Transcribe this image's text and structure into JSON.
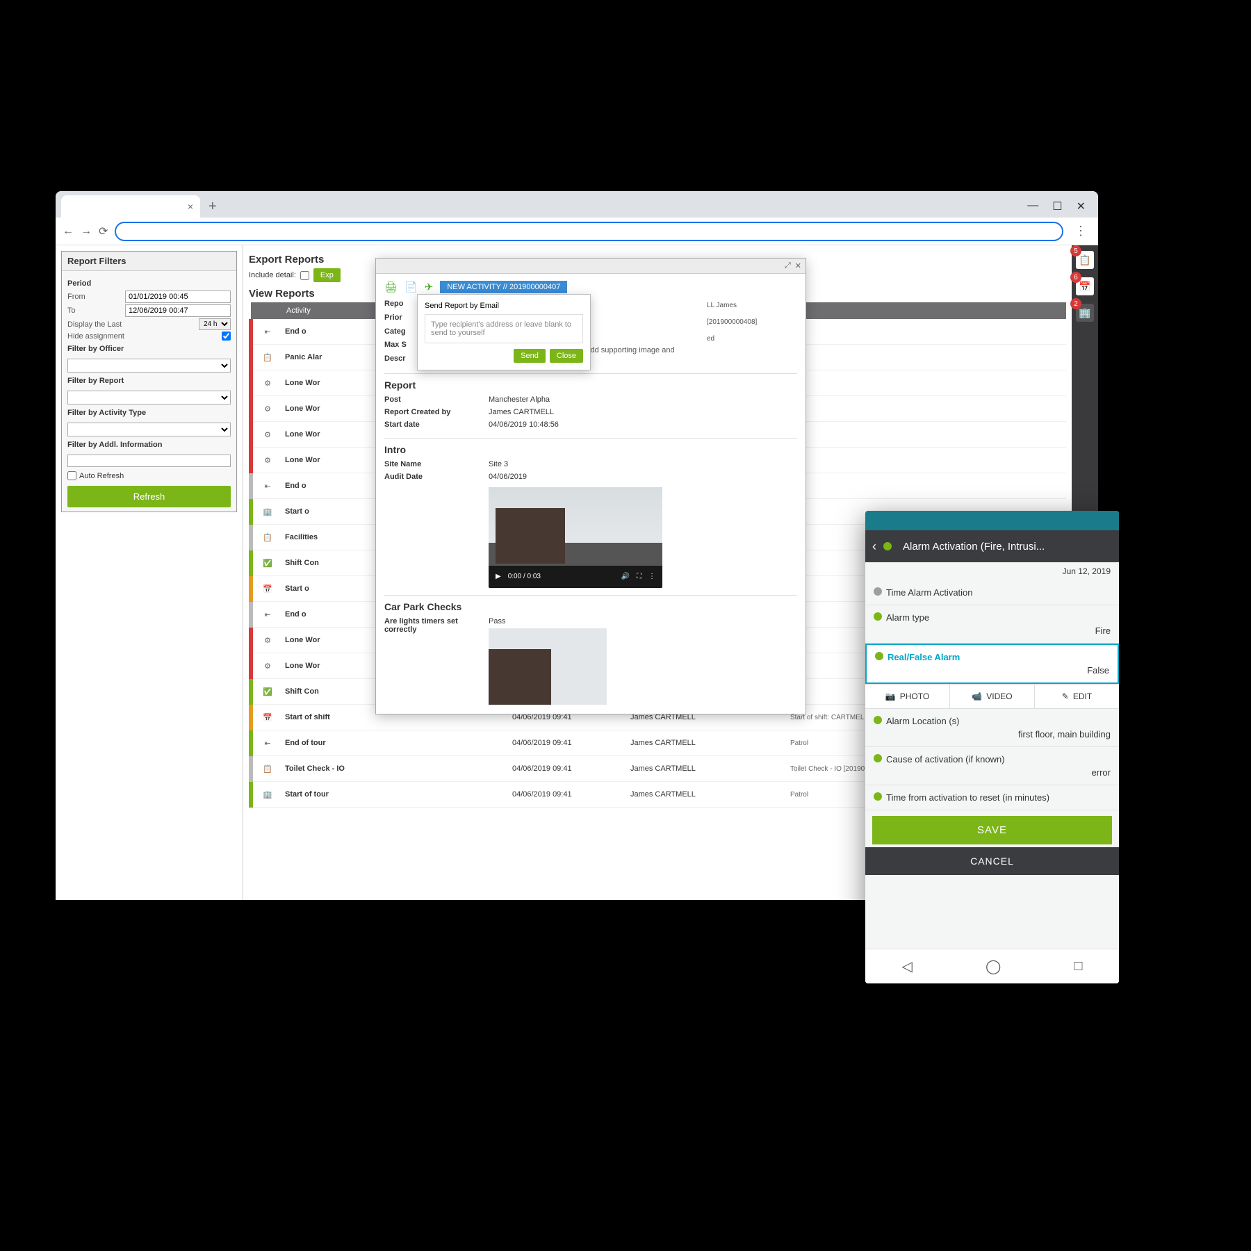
{
  "filters": {
    "title": "Report Filters",
    "period_label": "Period",
    "from_label": "From",
    "from_value": "01/01/2019 00:45",
    "to_label": "To",
    "to_value": "12/06/2019 00:47",
    "display_last_label": "Display the Last",
    "display_last_value": "24 h",
    "hide_assignment_label": "Hide assignment",
    "by_officer": "Filter by Officer",
    "by_report": "Filter by Report",
    "by_activity": "Filter by Activity Type",
    "by_addl": "Filter by Addl. Information",
    "auto_refresh": "Auto Refresh",
    "refresh_btn": "Refresh"
  },
  "export": {
    "title": "Export Reports",
    "include_detail_label": "Include detail:",
    "export_btn": "Exp"
  },
  "view": {
    "title": "View Reports",
    "col_activity": "Activity"
  },
  "rows": [
    {
      "color": "red",
      "icon": "arrow-in",
      "activity": "End o",
      "cls": "act-orange"
    },
    {
      "color": "red",
      "icon": "clipboard",
      "activity": "Panic Alar",
      "cls": "act-red"
    },
    {
      "color": "red",
      "icon": "gear",
      "activity": "Lone Wor",
      "cls": "act-red"
    },
    {
      "color": "red",
      "icon": "gear",
      "activity": "Lone Wor",
      "cls": "act-red"
    },
    {
      "color": "red",
      "icon": "gear",
      "activity": "Lone Wor",
      "cls": "act-red"
    },
    {
      "color": "red",
      "icon": "gear",
      "activity": "Lone Wor",
      "cls": "act-red"
    },
    {
      "color": "grey",
      "icon": "arrow-in",
      "activity": "End o",
      "cls": "act-orange"
    },
    {
      "color": "green",
      "icon": "building",
      "activity": "Start o",
      "cls": "act-green"
    },
    {
      "color": "grey",
      "icon": "clipboard",
      "activity": "Facilities",
      "cls": "act-red"
    },
    {
      "color": "green",
      "icon": "cal-check",
      "activity": "Shift Con",
      "cls": "act-green"
    },
    {
      "color": "orange",
      "icon": "cal",
      "activity": "Start o",
      "cls": "act-orange"
    },
    {
      "color": "grey",
      "icon": "arrow-in",
      "activity": "End o",
      "cls": "act-orange"
    },
    {
      "color": "red",
      "icon": "gear",
      "activity": "Lone Wor",
      "cls": "act-red"
    },
    {
      "color": "red",
      "icon": "gear",
      "activity": "Lone Wor",
      "cls": "act-red"
    },
    {
      "color": "green",
      "icon": "cal-check",
      "activity": "Shift Con",
      "cls": "act-green"
    }
  ],
  "full_rows": [
    {
      "color": "orange",
      "icon": "cal",
      "activity": "Start of shift",
      "cls": "act-orange",
      "dt": "04/06/2019 09:41",
      "who": "James CARTMELL",
      "info": "Start of shift: CARTMEL"
    },
    {
      "color": "green",
      "icon": "arrow-in",
      "activity": "End of tour",
      "cls": "act-green",
      "dt": "04/06/2019 09:41",
      "who": "James CARTMELL",
      "info": "Patrol"
    },
    {
      "color": "grey",
      "icon": "clipboard",
      "activity": "Toilet Check - IO",
      "cls": "act-green",
      "dt": "04/06/2019 09:41",
      "who": "James CARTMELL",
      "info": "Toilet Check - IO [20190"
    },
    {
      "color": "green",
      "icon": "building",
      "activity": "Start of tour",
      "cls": "act-green",
      "dt": "04/06/2019 09:41",
      "who": "James CARTMELL",
      "info": "Patrol"
    }
  ],
  "modal": {
    "new_activity": "NEW ACTIVITY // 201900000407",
    "report_label": "Repo",
    "priority_label": "Prior",
    "category_label": "Categ",
    "max_label": "Max S",
    "descr_label": "Descr",
    "descr_text": "group assets must use this form and add supporting image and video data",
    "side_person": "LL James",
    "side_id": "[201900000408]",
    "side_pd": "ed",
    "report_section": "Report",
    "post_k": "Post",
    "post_v": "Manchester Alpha",
    "created_k": "Report Created by",
    "created_v": "James CARTMELL",
    "startdate_k": "Start date",
    "startdate_v": "04/06/2019 10:48:56",
    "intro_section": "Intro",
    "site_k": "Site Name",
    "site_v": "Site 3",
    "audit_k": "Audit Date",
    "audit_v": "04/06/2019",
    "video_time": "0:00 / 0:03",
    "carpark_section": "Car Park Checks",
    "lights_k": "Are lights timers set correctly",
    "lights_v": "Pass"
  },
  "popover": {
    "title": "Send Report by Email",
    "hint": "Type recipient's address or leave blank to send to yourself",
    "send": "Send",
    "close": "Close"
  },
  "sidebar": {
    "b1": "5",
    "b2": "6",
    "b3": "2"
  },
  "phone": {
    "title": "Alarm Activation (Fire, Intrusi...",
    "date": "Jun 12, 2019",
    "f_time": "Time Alarm Activation",
    "f_type": "Alarm type",
    "f_type_v": "Fire",
    "f_real": "Real/False Alarm",
    "f_real_v": "False",
    "act_photo": "PHOTO",
    "act_video": "VIDEO",
    "act_edit": "EDIT",
    "f_loc": "Alarm Location (s)",
    "f_loc_v": "first floor, main building",
    "f_cause": "Cause of activation (if known)",
    "f_cause_v": "error",
    "f_reset": "Time from activation to reset (in minutes)",
    "save": "SAVE",
    "cancel": "CANCEL"
  }
}
